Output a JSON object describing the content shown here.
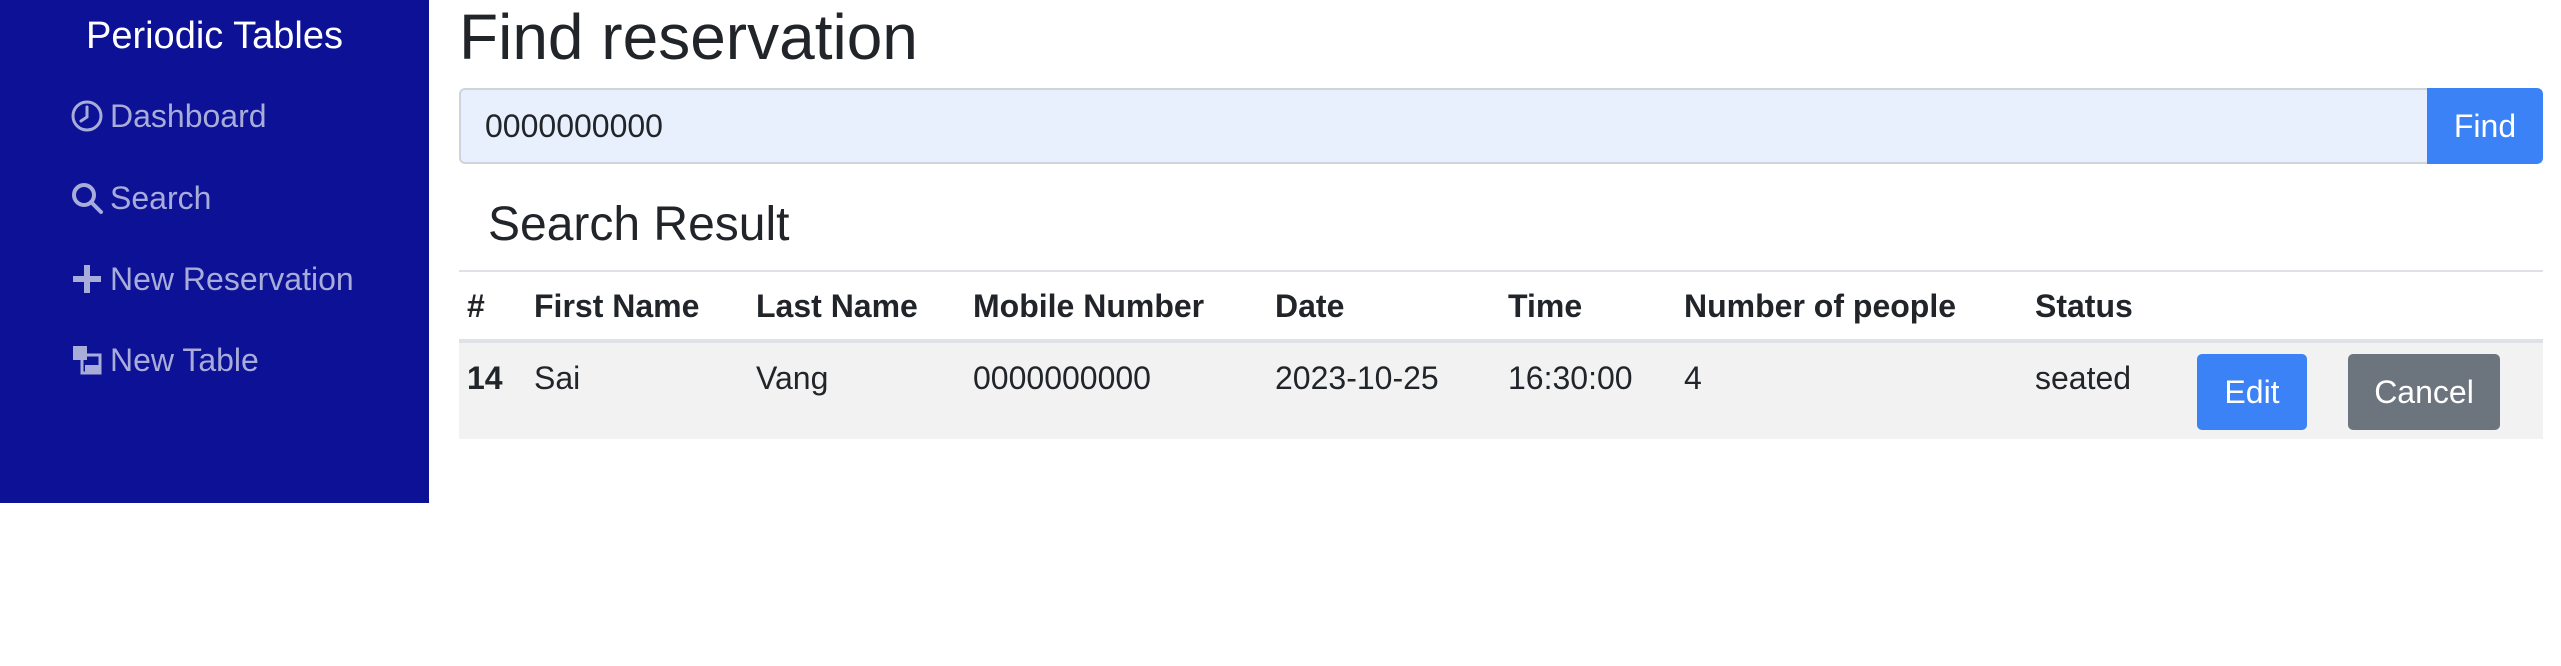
{
  "sidebar": {
    "brand": "Periodic Tables",
    "items": [
      {
        "label": "Dashboard",
        "icon": "dashboard-icon"
      },
      {
        "label": "Search",
        "icon": "search-icon"
      },
      {
        "label": "New Reservation",
        "icon": "plus-icon"
      },
      {
        "label": "New Table",
        "icon": "layers-icon"
      }
    ]
  },
  "main": {
    "title": "Find reservation",
    "search": {
      "value": "0000000000",
      "button_label": "Find"
    },
    "result_heading": "Search Result"
  },
  "table": {
    "headers": [
      "#",
      "First Name",
      "Last Name",
      "Mobile Number",
      "Date",
      "Time",
      "Number of people",
      "Status"
    ],
    "rows": [
      {
        "id": "14",
        "first_name": "Sai",
        "last_name": "Vang",
        "mobile": "0000000000",
        "date": "2023-10-25",
        "time": "16:30:00",
        "people": "4",
        "status": "seated",
        "edit_label": "Edit",
        "cancel_label": "Cancel"
      }
    ]
  },
  "colors": {
    "sidebar_bg": "#0c1196",
    "primary": "#3b82f6",
    "secondary": "#6c757d"
  }
}
